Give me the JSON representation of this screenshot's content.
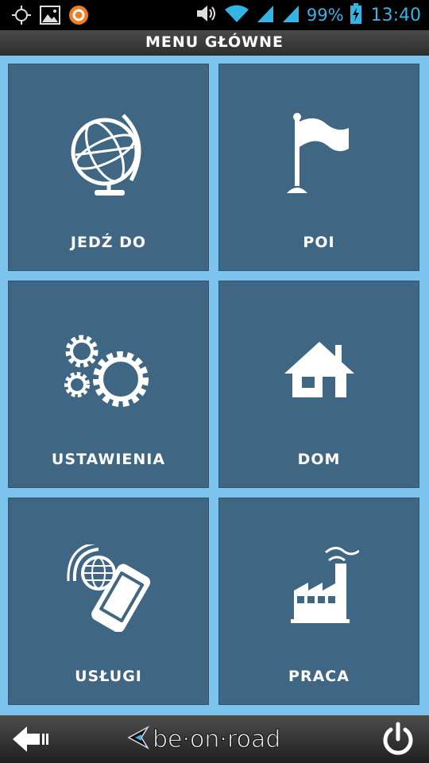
{
  "status_bar": {
    "battery": "99%",
    "time": "13:40",
    "icons": [
      "gps-icon",
      "gallery-icon",
      "app-notification-icon",
      "volume-icon",
      "wifi-icon",
      "signal-icon",
      "signal-icon",
      "battery-icon"
    ]
  },
  "header": {
    "title": "MENU GŁÓWNE"
  },
  "tiles": [
    {
      "label": "JEDŹ DO",
      "icon": "globe-icon"
    },
    {
      "label": "POI",
      "icon": "flag-icon"
    },
    {
      "label": "USTAWIENIA",
      "icon": "gears-icon"
    },
    {
      "label": "DOM",
      "icon": "house-icon"
    },
    {
      "label": "USŁUGI",
      "icon": "phone-globe-icon"
    },
    {
      "label": "PRACA",
      "icon": "factory-icon"
    }
  ],
  "footer": {
    "logo_text": "be·on·road",
    "icons": [
      "back-arrow-icon",
      "power-icon"
    ]
  },
  "colors": {
    "tile": "#3f6682",
    "grid_bg": "#7cc4ee",
    "status_accent": "#33b5e5"
  }
}
